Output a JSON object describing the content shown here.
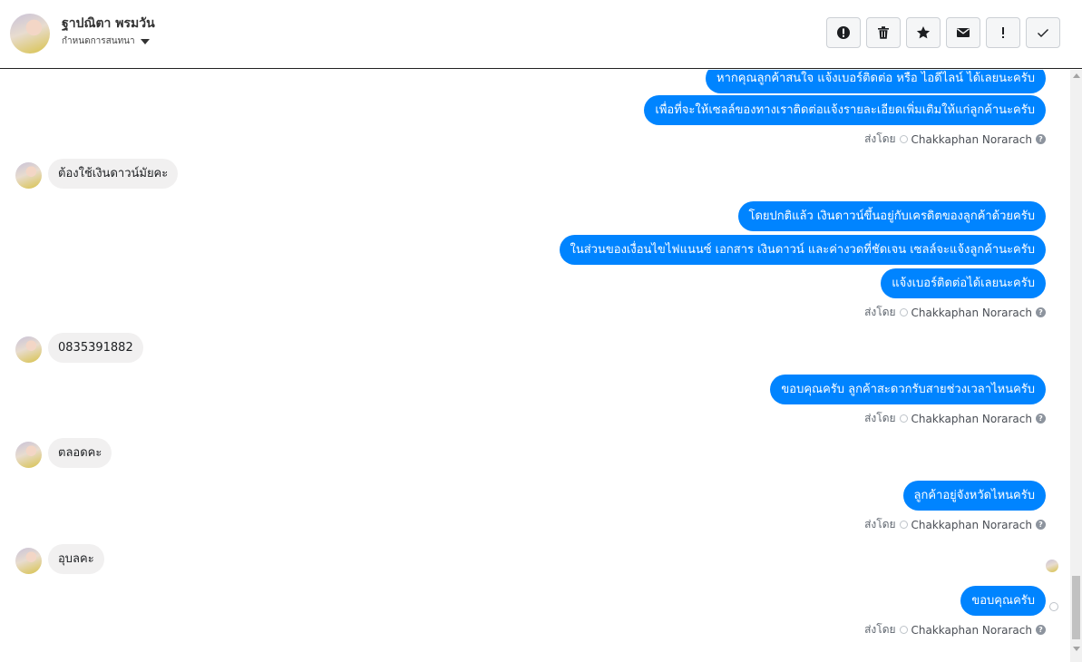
{
  "header": {
    "contact_name": "ฐาปณิตา พรมวัน",
    "subtitle": "กำหนดการสนทนา",
    "actions": [
      {
        "name": "report-icon",
        "label": "Report"
      },
      {
        "name": "delete-icon",
        "label": "Delete"
      },
      {
        "name": "star-icon",
        "label": "Star"
      },
      {
        "name": "mail-icon",
        "label": "Mark unread"
      },
      {
        "name": "priority-icon",
        "label": "Priority"
      },
      {
        "name": "done-icon",
        "label": "Done"
      }
    ]
  },
  "messages": {
    "o1": "หากคุณลูกค้าสนใจ แจ้งเบอร์ติดต่อ หรือ ไอดีไลน์ ได้เลยนะครับ",
    "o2": "เพื่อที่จะให้เซลล์ของทางเราติดต่อแจ้งรายละเอียดเพิ่มเติมให้แก่ลูกค้านะครับ",
    "i1": "ต้องใช้เงินดาวน์มัยคะ",
    "o3": "โดยปกติแล้ว เงินดาวน์ขึ้นอยู่กับเครดิตของลูกค้าด้วยครับ",
    "o4": "ในส่วนของเงื่อนไขไฟแนนซ์ เอกสาร เงินดาวน์ และค่างวดที่ชัดเจน เซลล์จะแจ้งลูกค้านะครับ",
    "o5": "แจ้งเบอร์ติดต่อได้เลยนะครับ",
    "i2": "0835391882",
    "o6": "ขอบคุณครับ ลูกค้าสะดวกรับสายช่วงเวลาไหนครับ",
    "i3": "ตลอดคะ",
    "o7": "ลูกค้าอยู่จังหวัดไหนครับ",
    "i4": "อุบลคะ",
    "o8": "ขอบคุณครับ"
  },
  "sent_by": {
    "prefix": "ส่งโดย",
    "sender": "Chakkaphan Norarach",
    "help": "?"
  },
  "colors": {
    "outgoing_bubble": "#0084ff",
    "incoming_bubble": "#f1f0f0"
  }
}
